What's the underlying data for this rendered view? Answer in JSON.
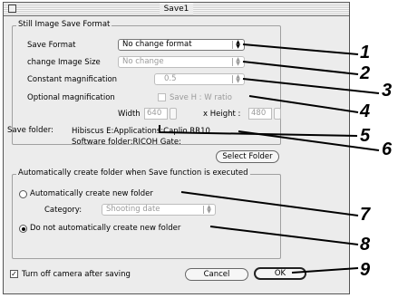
{
  "window": {
    "title": "Save1"
  },
  "still_image": {
    "group_title": "Still Image Save Format",
    "save_format_label": "Save Format",
    "save_format_value": "No change format",
    "change_size_label": "change Image Size",
    "change_size_value": "No change",
    "constant_mag_label": "Constant magnification",
    "constant_mag_value": "0.5",
    "optional_mag_label": "Optional magnification",
    "save_hw_label": "Save H : W ratio",
    "width_label": "Width",
    "width_value": "640",
    "height_label": "x Height :",
    "height_value": "480"
  },
  "save_folder": {
    "label": "Save folder:",
    "path": "Hibiscus E:Applications:Caplio RR10 Software folder:RICOH Gate:",
    "select_button": "Select Folder"
  },
  "auto_folder": {
    "group_title": "Automatically create folder when Save function is executed",
    "auto_create_label": "Automatically create new folder",
    "category_label": "Category:",
    "category_value": "Shooting date",
    "no_auto_label": "Do not automatically create new folder"
  },
  "footer": {
    "turn_off_label": "Turn off camera after saving",
    "cancel_button": "Cancel",
    "ok_button": "OK"
  },
  "callouts": [
    "1",
    "2",
    "3",
    "4",
    "5",
    "6",
    "7",
    "8",
    "9"
  ]
}
